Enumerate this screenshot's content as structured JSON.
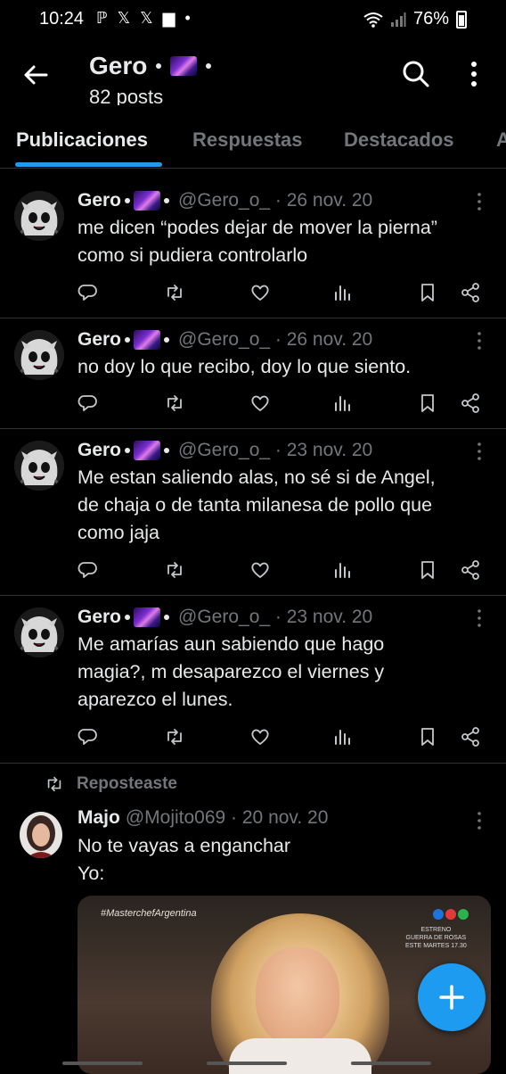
{
  "status_bar": {
    "time": "10:24",
    "left_icons": "ℙ 𝕏 𝕏 ▆ •",
    "battery": "76%"
  },
  "header": {
    "name": "Gero",
    "posts": "82 posts"
  },
  "tabs": [
    {
      "label": "Publicaciones",
      "active": true
    },
    {
      "label": "Respuestas",
      "active": false
    },
    {
      "label": "Destacados",
      "active": false
    },
    {
      "label": "A",
      "active": false
    }
  ],
  "tweets": [
    {
      "name": "Gero",
      "handle": "@Gero_o_ · 26 nov. 20",
      "lines": [
        "me dicen “podes dejar de mover la pierna”",
        "como si pudiera controlarlo"
      ]
    },
    {
      "name": "Gero",
      "handle": "@Gero_o_ · 26 nov. 20",
      "lines": [
        "no doy lo que recibo, doy lo que siento."
      ]
    },
    {
      "name": "Gero",
      "handle": "@Gero_o_ · 23 nov. 20",
      "lines": [
        "Me estan saliendo alas, no sé si de Angel,",
        "de chaja o de tanta milanesa de pollo que",
        "como jaja"
      ]
    },
    {
      "name": "Gero",
      "handle": "@Gero_o_ · 23 nov. 20",
      "lines": [
        "Me amarías aun sabiendo que hago",
        "magia?, m desaparezco el viernes y",
        "aparezco el lunes."
      ]
    }
  ],
  "repost": {
    "label": "Reposteaste",
    "name": "Majo",
    "handle": "@Mojito069 · 20 nov. 20",
    "lines": [
      "No te vayas a enganchar",
      "Yo:"
    ],
    "media_tag": "#MasterchefArgentina",
    "media_promo": [
      "ESTRENO",
      "GUERRA DE ROSAS",
      "ESTE MARTES 17.30"
    ]
  },
  "colors": {
    "accent": "#1d9bf0",
    "background": "#000000",
    "secondary_text": "#71767b"
  }
}
